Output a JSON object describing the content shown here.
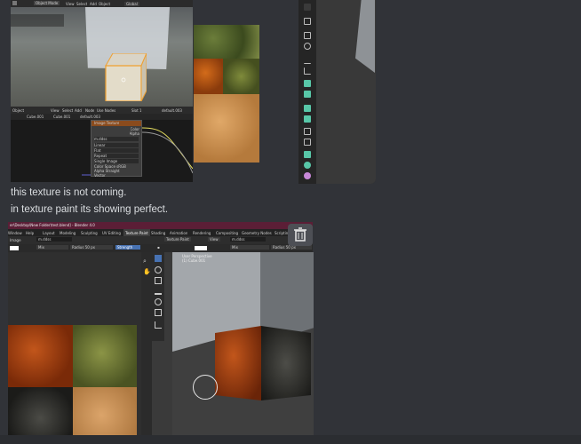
{
  "messages": {
    "line1": "this texture is not coming.",
    "line2": "in texture paint its showing perfect."
  },
  "shot1": {
    "mode": "Object Mode",
    "menu": [
      "View",
      "Select",
      "Add",
      "Object"
    ],
    "shading": "Global",
    "editor_menu": [
      "Object",
      "View",
      "Select",
      "Add",
      "Node",
      "Use Nodes",
      "Slot 1",
      "default.003"
    ],
    "breadcrumb": [
      "Cube.001",
      "Cube.001",
      "default.003"
    ],
    "node": {
      "title": "Image Texture",
      "outputs": [
        "Color",
        "Alpha"
      ],
      "image": "m.ddss",
      "fields": [
        "Linear",
        "Flat",
        "Repeat",
        "Single Image",
        "Color Space sRGB",
        "Alpha Straight",
        "Vector"
      ]
    }
  },
  "shot3": {
    "title": "er\\Desktop\\New Folder\\test.blend] - Blender 4.0",
    "menu": [
      "Window",
      "Help"
    ],
    "tabs": [
      "Layout",
      "Modeling",
      "Sculpting",
      "UV Editing",
      "Texture Paint",
      "Shading",
      "Animation",
      "Rendering",
      "Compositing",
      "Geometry Nodes",
      "Scripting"
    ],
    "active_tab": "Texture Paint",
    "image_editor": {
      "mode": "Image",
      "image_name": "m.ddss",
      "blend": "Mix",
      "radius_label": "Radius",
      "radius_value": "50 px",
      "strength_label": "Strength"
    },
    "viewport": {
      "mode": "Texture Paint",
      "view": "View",
      "image_name": "m.ddss",
      "blend": "Mix",
      "radius_label": "Radius",
      "radius_value": "50 px",
      "brush": "TexDraw",
      "overlay1": "User Perspective",
      "overlay2": "(1) Cube.001"
    }
  }
}
